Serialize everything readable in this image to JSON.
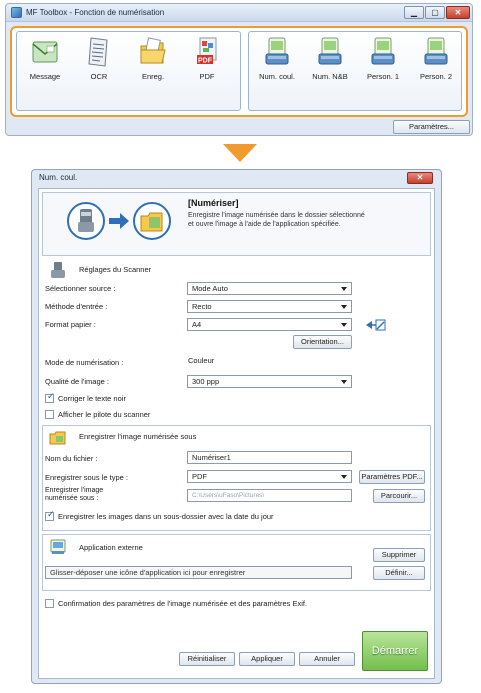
{
  "toolbox": {
    "title": "MF Toolbox - Fonction de numérisation",
    "buttons_group1": [
      {
        "label": "Message",
        "icon": "envelope-icon"
      },
      {
        "label": "OCR",
        "icon": "document-text-icon"
      },
      {
        "label": "Enreg.",
        "icon": "folder-icon"
      },
      {
        "label": "PDF",
        "icon": "pdf-icon"
      }
    ],
    "buttons_group2": [
      {
        "label": "Num. coul.",
        "icon": "scan-color-icon"
      },
      {
        "label": "Num. N&B",
        "icon": "scan-bw-icon"
      },
      {
        "label": "Person. 1",
        "icon": "scan-custom1-icon"
      },
      {
        "label": "Person. 2",
        "icon": "scan-custom2-icon"
      }
    ],
    "params_button": "Paramètres..."
  },
  "dialog": {
    "title": "Num. coul.",
    "header": {
      "title": "[Numériser]",
      "description": "Enregistre l'image numérisée dans le dossier sélectionné et ouvre l'image à l'aide de l'application spécifiée."
    },
    "scanner": {
      "section_title": "Réglages du Scanner",
      "source_label": "Sélectionner source :",
      "source_value": "Mode Auto",
      "input_method_label": "Méthode d'entrée :",
      "input_method_value": "Recto",
      "paper_format_label": "Format papier :",
      "paper_format_value": "A4",
      "orientation_button": "Orientation...",
      "scan_mode_label": "Mode de numérisation :",
      "scan_mode_value": "Couleur",
      "quality_label": "Qualité de l'image :",
      "quality_value": "300 ppp",
      "correct_text_label": "Corriger le texte noir",
      "correct_text_checked": true,
      "show_driver_label": "Afficher le pilote du scanner",
      "show_driver_checked": false
    },
    "save": {
      "section_title": "Enregistrer l'image numérisée sous",
      "filename_label": "Nom du fichier :",
      "filename_value": "Numériser1",
      "type_label": "Enregistrer sous le type :",
      "type_value": "PDF",
      "pdf_params_button": "Paramètres PDF...",
      "location_label": "Enregistrer l'image numérisée sous :",
      "location_value": "C:\\Users\\uFaso\\Pictures\\",
      "browse_button": "Parcourir...",
      "subfolder_label": "Enregistrer les images dans un sous-dossier avec la date du jour",
      "subfolder_checked": true
    },
    "app": {
      "section_title": "Application externe",
      "remove_button": "Supprimer",
      "drop_hint": "Glisser-déposer une icône d'application ici pour enregistrer",
      "define_button": "Définir..."
    },
    "footer": {
      "confirm_label": "Confirmation des paramètres de l'image numérisée et des paramètres Exif.",
      "confirm_checked": false,
      "reset_button": "Réinitialiser",
      "apply_button": "Appliquer",
      "cancel_button": "Annuler",
      "start_button": "Démarrer"
    }
  },
  "colors": {
    "accent_orange": "#f19a2e",
    "start_green": "#74bf4d",
    "title_blue": "#dfe8f3"
  }
}
